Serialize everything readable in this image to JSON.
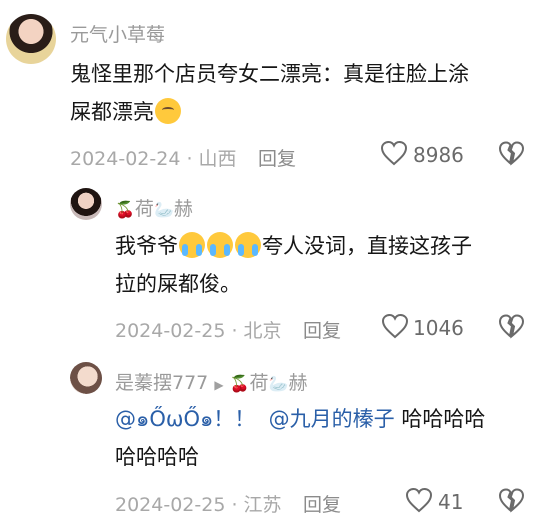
{
  "comments": [
    {
      "username": "元气小草莓",
      "content_text": "鬼怪里那个店员夸女二漂亮：真是往脸上涂屎都漂亮",
      "line1": "鬼怪里那个店员夸女二漂亮：真是往脸上涂",
      "line2": "屎都漂亮",
      "date_location": "2024-02-24 · 山西",
      "reply_label": "回复",
      "likes": "8986"
    },
    {
      "username_part1": "荷",
      "username_part2": "赫",
      "line1_a": "我爷爷",
      "line1_b": "夸人没词，直接这孩子",
      "line2": "拉的屎都俊。",
      "date_location": "2024-02-25 · 北京",
      "reply_label": "回复",
      "likes": "1046"
    },
    {
      "username": "是蓁摆777",
      "reply_to_part1": "荷",
      "reply_to_part2": "赫",
      "mention1": "@๑ŐωŐ๑！！",
      "mention2": "@九月的榛子",
      "line1_rest": "哈哈哈哈",
      "line2": "哈哈哈哈",
      "date_location": "2024-02-25 · 江苏",
      "reply_label": "回复",
      "likes": "41"
    }
  ],
  "icons": {
    "like": "heart-icon",
    "dislike": "broken-heart-icon",
    "cherry": "🍒",
    "goose": "goose-icon"
  }
}
